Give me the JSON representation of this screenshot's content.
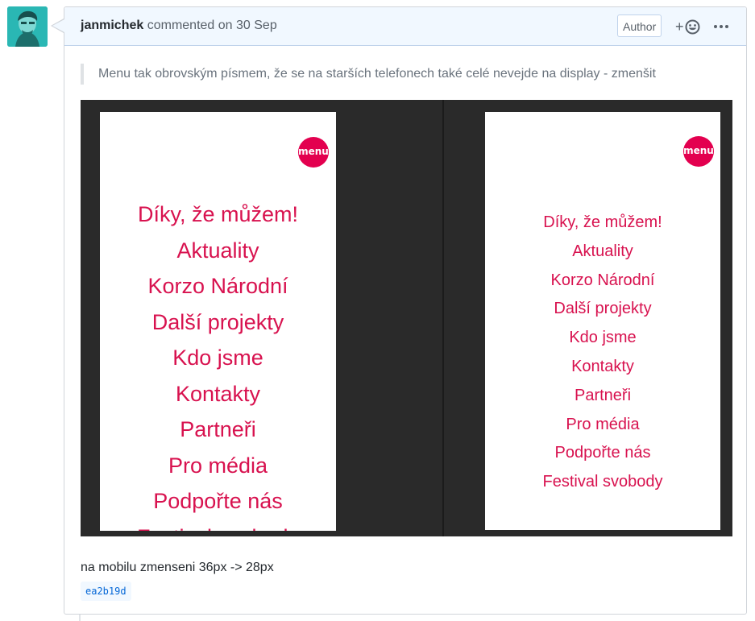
{
  "comment": {
    "author": "janmichek",
    "action": "commented on",
    "date": "30 Sep",
    "badge": "Author",
    "reaction_plus": "+",
    "quote": "Menu tak obrovským písmem, že se na starších telefonech také celé nevejde na display - zmenšit",
    "footer_text": "na mobilu zmenseni 36px -> 28px",
    "commit_sha": "ea2b19d"
  },
  "screenshot": {
    "badge_label": "menu",
    "before_items": [
      "Díky, že můžem!",
      "Aktuality",
      "Korzo Národní",
      "Další projekty",
      "Kdo jsme",
      "Kontakty",
      "Partneři",
      "Pro média",
      "Podpořte nás",
      "Festival svobody"
    ],
    "after_items": [
      "Díky, že můžem!",
      "Aktuality",
      "Korzo Národní",
      "Další projekty",
      "Kdo jsme",
      "Kontakty",
      "Partneři",
      "Pro média",
      "Podpořte nás",
      "Festival svobody"
    ]
  },
  "icons": {
    "avatar": "user-avatar",
    "reaction": "smiley-icon",
    "more": "kebab-horizontal-icon"
  },
  "colors": {
    "header_bg": "#f1f8ff",
    "menu_pink": "#d8124f",
    "link_blue": "#0366d6"
  }
}
